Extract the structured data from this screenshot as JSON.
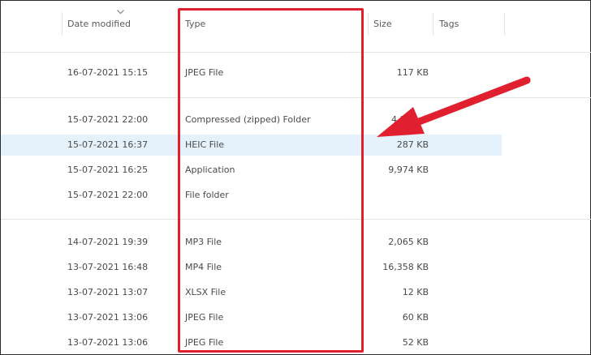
{
  "header": {
    "date_modified": "Date modified",
    "type": "Type",
    "size": "Size",
    "tags": "Tags"
  },
  "rows": [
    {
      "date": "16-07-2021 15:15",
      "type": "JPEG File",
      "size": "117 KB"
    },
    {
      "date": "15-07-2021 22:00",
      "type": "Compressed (zipped) Folder",
      "size": "4,1"
    },
    {
      "date": "15-07-2021 16:37",
      "type": "HEIC File",
      "size": "287 KB",
      "selected": true
    },
    {
      "date": "15-07-2021 16:25",
      "type": "Application",
      "size": "9,974 KB"
    },
    {
      "date": "15-07-2021 22:00",
      "type": "File folder",
      "size": ""
    },
    {
      "date": "14-07-2021 19:39",
      "type": "MP3 File",
      "size": "2,065 KB"
    },
    {
      "date": "13-07-2021 16:48",
      "type": "MP4 File",
      "size": "16,358 KB"
    },
    {
      "date": "13-07-2021 13:07",
      "type": "XLSX File",
      "size": "12 KB"
    },
    {
      "date": "13-07-2021 13:06",
      "type": "JPEG File",
      "size": "60 KB"
    },
    {
      "date": "13-07-2021 13:06",
      "type": "JPEG File",
      "size": "52 KB"
    }
  ],
  "colors": {
    "highlight": "#e0202e",
    "selection": "#e5f1fb"
  },
  "icons": {
    "sort": "chevron-down-icon",
    "arrow": "annotation-arrow-icon"
  }
}
